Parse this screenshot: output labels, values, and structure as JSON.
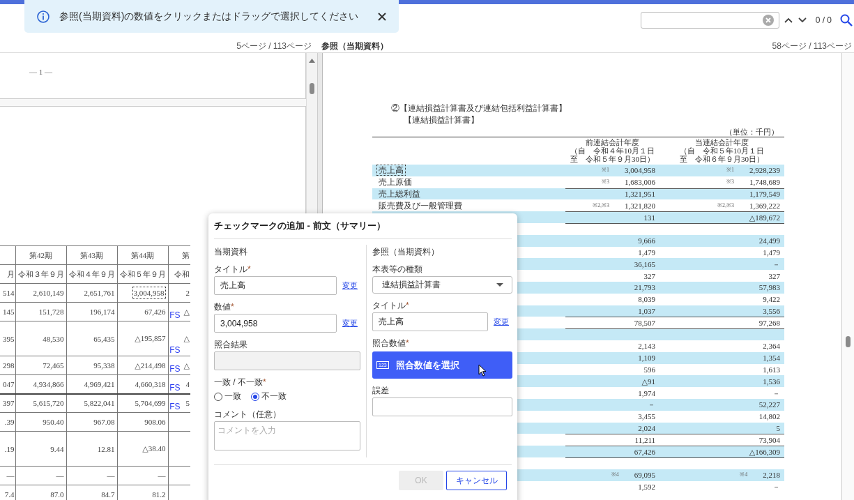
{
  "toast": {
    "text": "参照(当期資料)の数値をクリックまたはドラッグで選択してください"
  },
  "search": {
    "counter": "0 / 0"
  },
  "left_pane": {
    "page_label": "5ページ / 113ページ",
    "page_number": "— 1 —",
    "table": {
      "period_row": [
        "第42期",
        "第43期",
        "第44期",
        "第"
      ],
      "date_row": [
        "月",
        "令和３年９月",
        "令和４年９月",
        "令和５年９月",
        "令和"
      ],
      "rows": [
        {
          "cells": [
            "514",
            "2,610,149",
            "2,651,761",
            "3,004,958",
            "2"
          ],
          "cell_selected": true,
          "tall": false,
          "ruled": false
        },
        {
          "cells": [
            "145",
            "151,728",
            "196,174",
            "67,426",
            "△"
          ],
          "cell_selected": false,
          "mark": "FS",
          "tall": false,
          "ruled": false
        },
        {
          "cells": [
            "395",
            "48,530",
            "65,435",
            "△195,857",
            "△"
          ],
          "cell_selected": false,
          "mark": "FS",
          "tall": true,
          "ruled": false
        },
        {
          "cells": [
            "298",
            "72,465",
            "95,338",
            "△214,498",
            "△"
          ],
          "cell_selected": false,
          "mark": "FS",
          "tall": false,
          "ruled": false
        },
        {
          "cells": [
            "047",
            "4,934,866",
            "4,969,421",
            "4,660,318",
            "4"
          ],
          "cell_selected": false,
          "mark": "FS",
          "tall": false,
          "ruled": false
        },
        {
          "cells": [
            "397",
            "5,615,720",
            "5,822,041",
            "5,704,699",
            "5"
          ],
          "cell_selected": false,
          "mark": "FS",
          "tall": false,
          "ruled": true
        },
        {
          "cells": [
            ".39",
            "950.40",
            "967.08",
            "908.06"
          ],
          "cell_selected": false,
          "tall": false,
          "ruled": false
        },
        {
          "cells": [
            ".19",
            "9.44",
            "12.81",
            "△38.40"
          ],
          "cell_selected": false,
          "tall": true,
          "ruled": false
        },
        {
          "cells": [
            "—",
            "—",
            "—",
            "—"
          ],
          "cell_selected": false,
          "tall": false,
          "ruled": false
        },
        {
          "cells": [
            "7.4",
            "87.0",
            "84.7",
            "81.2"
          ],
          "cell_selected": false,
          "tall": false,
          "ruled": false
        }
      ]
    }
  },
  "right_pane": {
    "header_label": "参照（当期資料）",
    "page_label": "58ページ / 113ページ",
    "heading": "②【連結損益計算書及び連結包括利益計算書】",
    "subheading": "【連結損益計算書】",
    "unit": "（単位：千円）",
    "columns": [
      {
        "lines": [
          "前連結会計年度",
          "（自　令和４年10月１日",
          "至　令和５年９月30日）"
        ]
      },
      {
        "lines": [
          "当連結会計年度",
          "（自　令和５年10月１日",
          "至　令和６年９月30日）"
        ]
      }
    ],
    "rows": [
      {
        "label": "売上高",
        "selected": true,
        "highlighted": true,
        "ruled": false,
        "prev_note": "※1",
        "prev": "3,004,958",
        "curr_note": "※1",
        "curr": "2,928,239"
      },
      {
        "label": "売上原価",
        "selected": false,
        "highlighted": false,
        "ruled": false,
        "prev_note": "※3",
        "prev": "1,683,006",
        "curr_note": "※3",
        "curr": "1,748,689"
      },
      {
        "label": "売上総利益",
        "selected": false,
        "highlighted": true,
        "ruled": true,
        "prev": "1,321,951",
        "curr": "1,179,549"
      },
      {
        "label": "販売費及び一般管理費",
        "selected": false,
        "highlighted": false,
        "ruled": false,
        "prev_note": "※2,※3",
        "prev": "1,321,820",
        "curr_note": "※2,※3",
        "curr": "1,369,222"
      },
      {
        "highlighted": true,
        "ruled": true,
        "prev": "131",
        "curr": "△189,672"
      },
      {
        "highlighted": false,
        "ruled": true
      },
      {
        "highlighted": true,
        "ruled": false,
        "prev": "9,666",
        "curr": "24,499"
      },
      {
        "highlighted": false,
        "ruled": false,
        "prev": "1,479",
        "curr": "1,479"
      },
      {
        "highlighted": true,
        "ruled": false,
        "prev": "36,165",
        "curr": "－"
      },
      {
        "highlighted": false,
        "ruled": false,
        "prev": "327",
        "curr": "327"
      },
      {
        "highlighted": true,
        "ruled": false,
        "prev": "21,793",
        "curr": "57,983"
      },
      {
        "highlighted": false,
        "ruled": false,
        "prev": "8,039",
        "curr": "9,422"
      },
      {
        "highlighted": true,
        "ruled": false,
        "prev": "1,037",
        "curr": "3,556"
      },
      {
        "highlighted": false,
        "ruled": true,
        "prev": "78,507",
        "curr": "97,268"
      },
      {
        "highlighted": true,
        "ruled": true
      },
      {
        "highlighted": false,
        "ruled": false,
        "prev": "2,143",
        "curr": "2,364"
      },
      {
        "highlighted": true,
        "ruled": false,
        "prev": "1,109",
        "curr": "1,354"
      },
      {
        "highlighted": false,
        "ruled": false,
        "prev": "596",
        "curr": "1,613"
      },
      {
        "highlighted": true,
        "ruled": false,
        "prev": "△91",
        "curr": "1,536"
      },
      {
        "highlighted": false,
        "ruled": false,
        "prev": "1,974",
        "curr": "－"
      },
      {
        "highlighted": true,
        "ruled": false,
        "prev": "－",
        "curr": "52,227"
      },
      {
        "highlighted": false,
        "ruled": false,
        "prev": "3,455",
        "curr": "14,802"
      },
      {
        "highlighted": true,
        "ruled": false,
        "prev": "2,024",
        "curr": "5"
      },
      {
        "highlighted": false,
        "ruled": true,
        "prev": "11,211",
        "curr": "73,904"
      },
      {
        "highlighted": true,
        "ruled": true,
        "prev": "67,426",
        "curr": "△166,309"
      },
      {
        "highlighted": false,
        "ruled": true
      },
      {
        "highlighted": true,
        "ruled": false,
        "prev_note": "※4",
        "prev": "69,095",
        "curr_note": "※4",
        "curr": "2,218"
      },
      {
        "highlighted": false,
        "ruled": false,
        "prev": "1,592",
        "curr": "－"
      }
    ]
  },
  "dialog": {
    "title": "チェックマークの追加 - 前文（サマリー）",
    "left": {
      "heading": "当期資料",
      "title_field": {
        "label": "タイトル",
        "mark": "*",
        "value": "売上高",
        "link": "変更"
      },
      "value_field": {
        "label": "数値",
        "mark": "*",
        "value": "3,004,958",
        "link": "変更"
      },
      "result_field": {
        "label": "照合結果",
        "disabled": true
      },
      "match": {
        "label": "一致 / 不一致",
        "mark": "*",
        "options": [
          {
            "label": "一致",
            "selected": false
          },
          {
            "label": "不一致",
            "selected": true
          }
        ]
      },
      "comment": {
        "label": "コメント（任意）",
        "placeholder": "コメントを入力"
      }
    },
    "right": {
      "heading": "参照（当期資料）",
      "type_field": {
        "label": "本表等の種類",
        "value": "連結損益計算書"
      },
      "title_field": {
        "label": "タイトル",
        "mark": "*",
        "value": "売上高",
        "link": "変更"
      },
      "pick": {
        "label": "照合数値",
        "mark": "*",
        "icon_text": "123",
        "button": "照合数値を選択"
      },
      "error_field": {
        "label": "誤差"
      }
    },
    "buttons": [
      {
        "label": "OK",
        "disabled": true
      },
      {
        "label": "キャンセル",
        "disabled": false
      }
    ]
  }
}
